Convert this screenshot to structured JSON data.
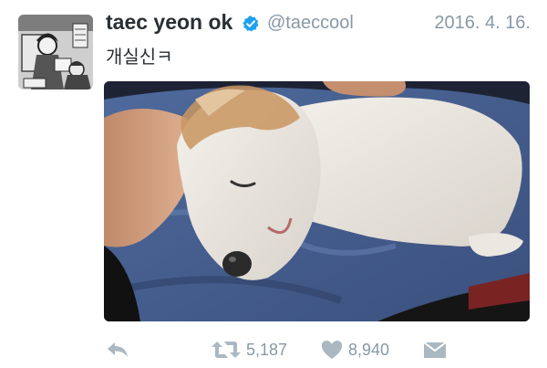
{
  "tweet": {
    "display_name": "taec yeon ok",
    "handle": "@taeccool",
    "date": "2016. 4. 16.",
    "text": "개실신ㅋ",
    "verified": true
  },
  "avatar": {
    "icon": "manga-avatar"
  },
  "media": {
    "icon": "sleeping-dog-photo"
  },
  "actions": {
    "reply_icon": "reply-icon",
    "retweet_icon": "retweet-icon",
    "retweet_count": "5,187",
    "like_icon": "heart-icon",
    "like_count": "8,940",
    "dm_icon": "direct-message-icon"
  },
  "colors": {
    "name": "#292f33",
    "muted": "#8899a6",
    "verified": "#1da1f2",
    "action_icon": "#aab8c2"
  }
}
